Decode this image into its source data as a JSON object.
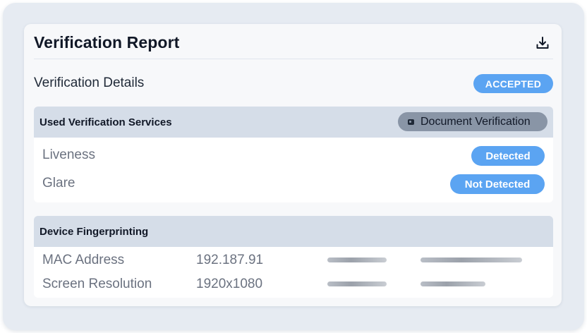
{
  "report": {
    "title": "Verification Report",
    "download_icon": "download-icon"
  },
  "details": {
    "label": "Verification Details",
    "status": "ACCEPTED"
  },
  "services": {
    "header": "Used Verification Services",
    "chip_label": "Document Verification",
    "chip_icon": "document-icon",
    "rows": [
      {
        "label": "Liveness",
        "status": "Detected"
      },
      {
        "label": "Glare",
        "status": "Not Detected"
      }
    ]
  },
  "fingerprint": {
    "header": "Device Fingerprinting",
    "rows": [
      {
        "label": "MAC Address",
        "value": "192.187.91"
      },
      {
        "label": "Screen Resolution",
        "value": "1920x1080"
      }
    ]
  },
  "colors": {
    "accent": "#5ba4f2",
    "section_header": "#d5dde8",
    "chip": "#8995a6"
  }
}
